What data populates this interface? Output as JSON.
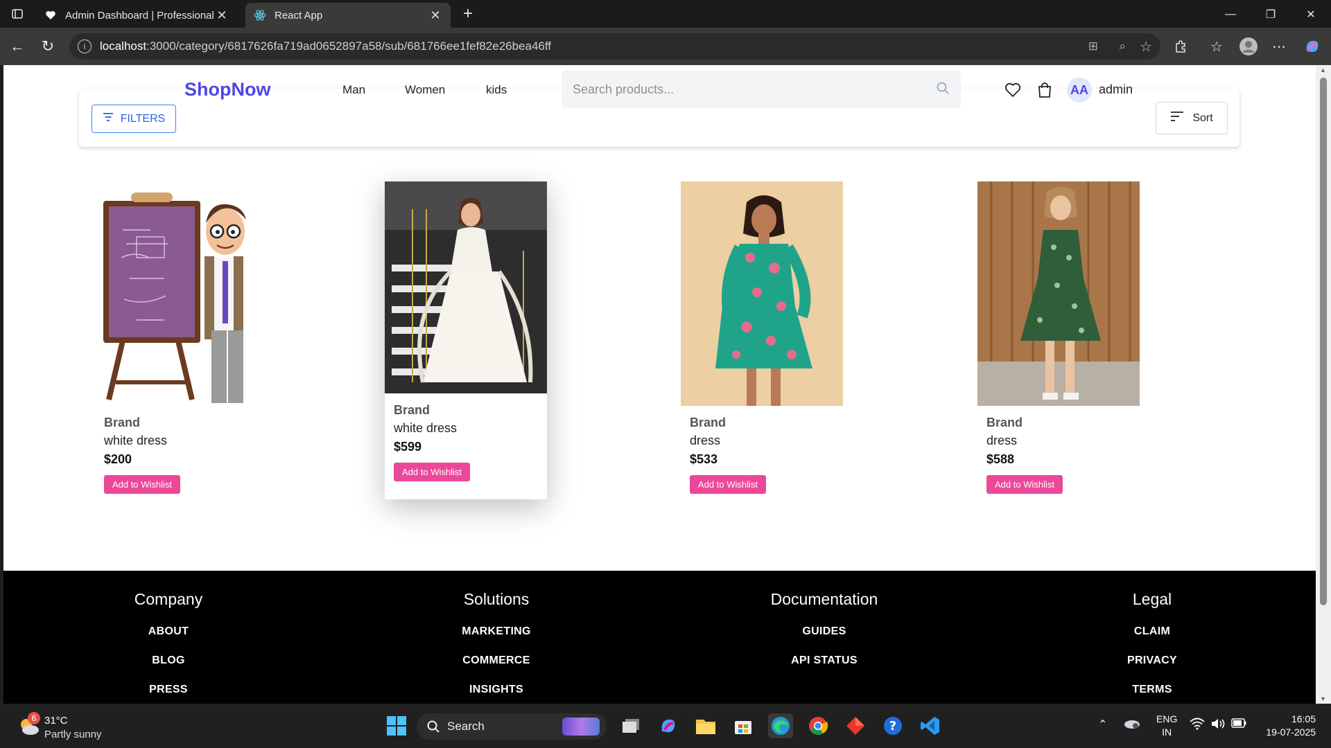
{
  "browser": {
    "tabs": [
      {
        "title": "Admin Dashboard | Professional N",
        "icon": "heart-icon"
      },
      {
        "title": "React App",
        "icon": "react-icon"
      }
    ],
    "url_host": "localhost",
    "url_path": ":3000/category/6817626fa719ad0652897a58/sub/681766ee1fef82e26bea46ff"
  },
  "header": {
    "brand": "ShopNow",
    "nav": [
      "Man",
      "Women",
      "kids"
    ],
    "search_placeholder": "Search products...",
    "avatar_initials": "AA",
    "username": "admin",
    "filters_label": "FILTERS",
    "sort_label": "Sort"
  },
  "products": [
    {
      "brand": "Brand",
      "name": "white dress",
      "price": "$200",
      "button": "Add to Wishlist"
    },
    {
      "brand": "Brand",
      "name": "white dress",
      "price": "$599",
      "button": "Add to Wishlist"
    },
    {
      "brand": "Brand",
      "name": "dress",
      "price": "$533",
      "button": "Add to Wishlist"
    },
    {
      "brand": "Brand",
      "name": "dress",
      "price": "$588",
      "button": "Add to Wishlist"
    }
  ],
  "footer": {
    "columns": [
      {
        "title": "Company",
        "links": [
          "ABOUT",
          "BLOG",
          "PRESS"
        ]
      },
      {
        "title": "Solutions",
        "links": [
          "MARKETING",
          "COMMERCE",
          "INSIGHTS"
        ]
      },
      {
        "title": "Documentation",
        "links": [
          "GUIDES",
          "API STATUS"
        ]
      },
      {
        "title": "Legal",
        "links": [
          "CLAIM",
          "PRIVACY",
          "TERMS"
        ]
      }
    ]
  },
  "taskbar": {
    "weather_badge": "6",
    "temperature": "31°C",
    "weather": "Partly sunny",
    "search_label": "Search",
    "lang": "ENG",
    "region": "IN",
    "time": "16:05",
    "date": "19-07-2025"
  },
  "colors": {
    "brand": "#4f46e5",
    "wishlist_button": "#ec4899",
    "filters_border": "#3b82f6"
  }
}
